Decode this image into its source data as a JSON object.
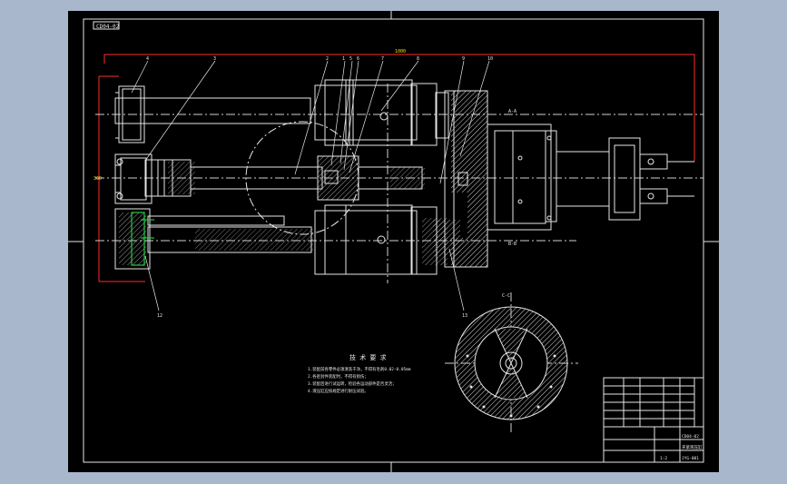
{
  "drawing_code": "CD04-02",
  "dimensions": {
    "overall_length": "1000",
    "height": "360"
  },
  "leaders": {
    "top": [
      "4",
      "3",
      "2",
      "1",
      "5",
      "6",
      "7",
      "8",
      "9",
      "10",
      "11"
    ],
    "bottom": [
      "12",
      "13"
    ]
  },
  "section_labels": {
    "a": "A-A",
    "b": "B-B",
    "c": "C-C"
  },
  "notes": {
    "title": "技 术 要 求",
    "lines": [
      "1.装配前各零件必须清洗干净，不得有毛刺0.02-0.05mm",
      "2.各密封件装配时，不得有损伤；",
      "3.装配后进行试运转，检验各运动部件是否灵活；",
      "4.液压缸应按规定进行耐压试验。"
    ]
  },
  "title_block": {
    "drawing_name": "夹紧液压缸",
    "scale": "1:2",
    "sheet": "CD04-02",
    "drawing_no": "JYG-001"
  }
}
